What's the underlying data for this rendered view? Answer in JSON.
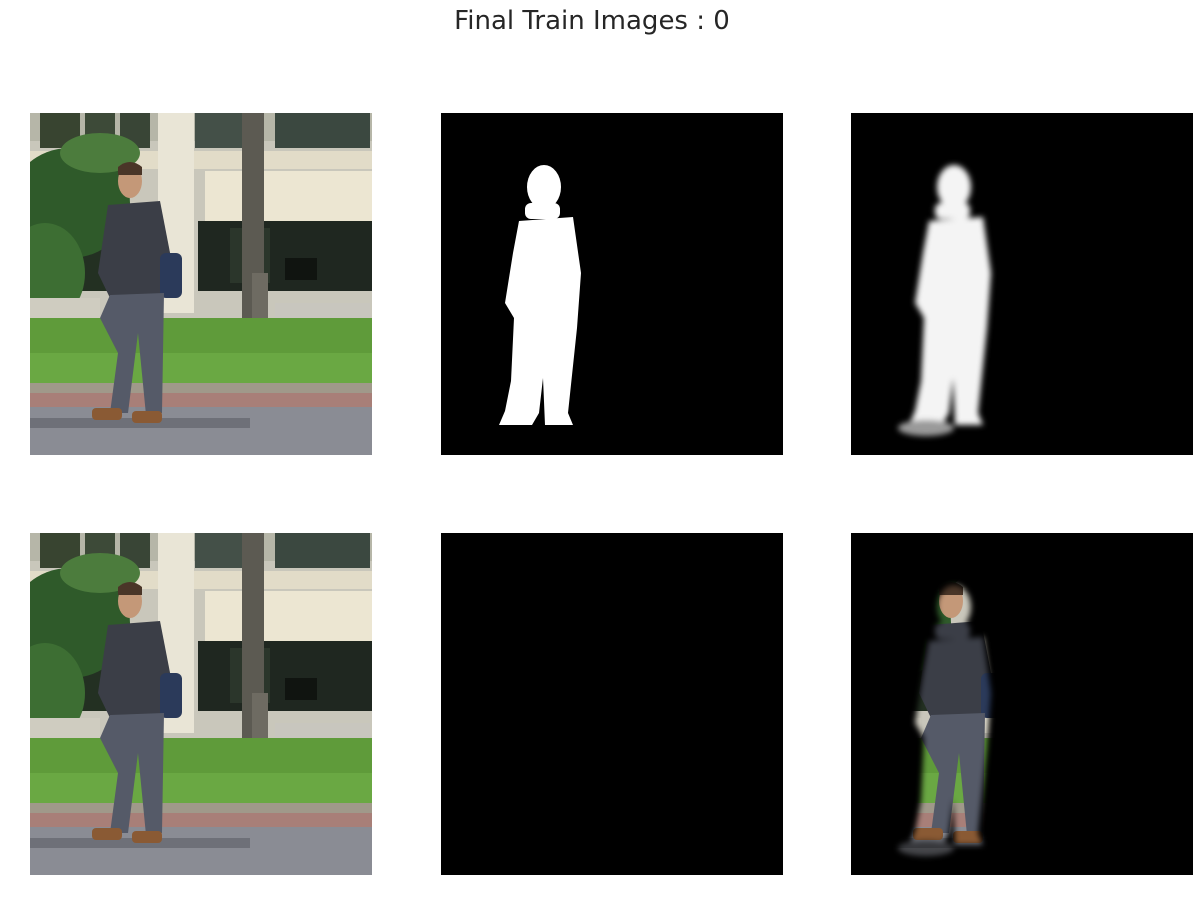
{
  "figure": {
    "title": "Final Train Images : 0"
  },
  "panels": [
    {
      "row": 1,
      "col": 1,
      "content": "input photo"
    },
    {
      "row": 1,
      "col": 2,
      "content": "ground-truth mask"
    },
    {
      "row": 1,
      "col": 3,
      "content": "predicted mask"
    },
    {
      "row": 2,
      "col": 1,
      "content": "input photo"
    },
    {
      "row": 2,
      "col": 2,
      "content": "ground-truth masked photo"
    },
    {
      "row": 2,
      "col": 3,
      "content": "predicted masked photo"
    }
  ],
  "colors": {
    "background": "#ffffff",
    "mask_bg": "#000000",
    "mask_fg": "#ffffff",
    "sky": "#ece6d6",
    "grass": "#5f9b3a",
    "road": "#8a8c94",
    "jacket": "#3b3e47",
    "trousers": "#555a68"
  }
}
